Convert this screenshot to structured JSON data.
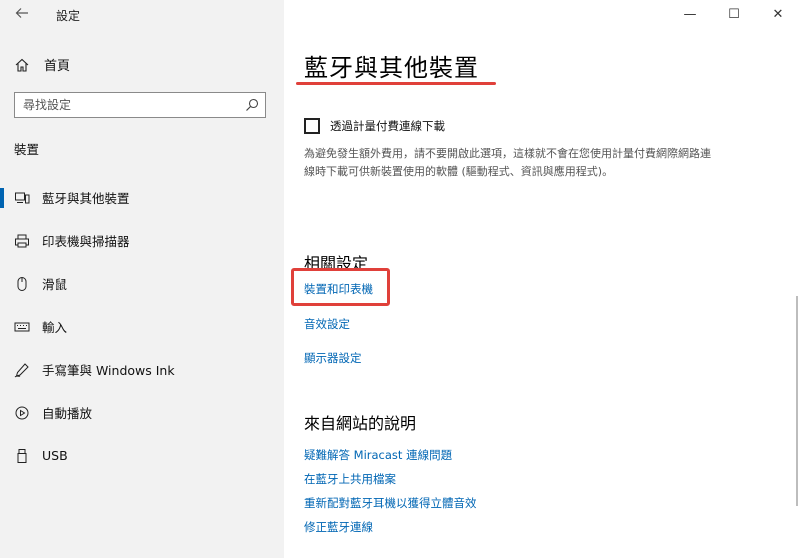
{
  "app": {
    "title": "設定"
  },
  "window_controls": {
    "minimize": "—",
    "maximize": "☐",
    "close": "✕"
  },
  "sidebar": {
    "home_label": "首頁",
    "search": {
      "placeholder": "尋找設定"
    },
    "section_label": "裝置",
    "items": [
      {
        "label": "藍牙與其他裝置",
        "icon": "bluetooth-devices-icon",
        "active": true
      },
      {
        "label": "印表機與掃描器",
        "icon": "printer-icon",
        "active": false
      },
      {
        "label": "滑鼠",
        "icon": "mouse-icon",
        "active": false
      },
      {
        "label": "輸入",
        "icon": "keyboard-icon",
        "active": false
      },
      {
        "label": "手寫筆與 Windows Ink",
        "icon": "pen-icon",
        "active": false
      },
      {
        "label": "自動播放",
        "icon": "autoplay-icon",
        "active": false
      },
      {
        "label": "USB",
        "icon": "usb-icon",
        "active": false
      }
    ]
  },
  "main": {
    "title": "藍牙與其他裝置",
    "metered": {
      "checkbox_label": "透過計量付費連線下載",
      "checked": false,
      "description": "為避免發生額外費用，請不要開啟此選項，這樣就不會在您使用計量付費網際網路連線時下載可供新裝置使用的軟體 (驅動程式、資訊與應用程式)。"
    },
    "related": {
      "heading": "相關設定",
      "links": [
        "裝置和印表機",
        "音效設定",
        "顯示器設定"
      ]
    },
    "web_help": {
      "heading": "來自網站的說明",
      "links": [
        "疑難解答 Miracast 連線問題",
        "在藍牙上共用檔案",
        "重新配對藍牙耳機以獲得立體音效",
        "修正藍牙連線"
      ]
    }
  },
  "colors": {
    "accent": "#0063b1",
    "link": "#0066b4",
    "annotation": "#e0403a"
  }
}
